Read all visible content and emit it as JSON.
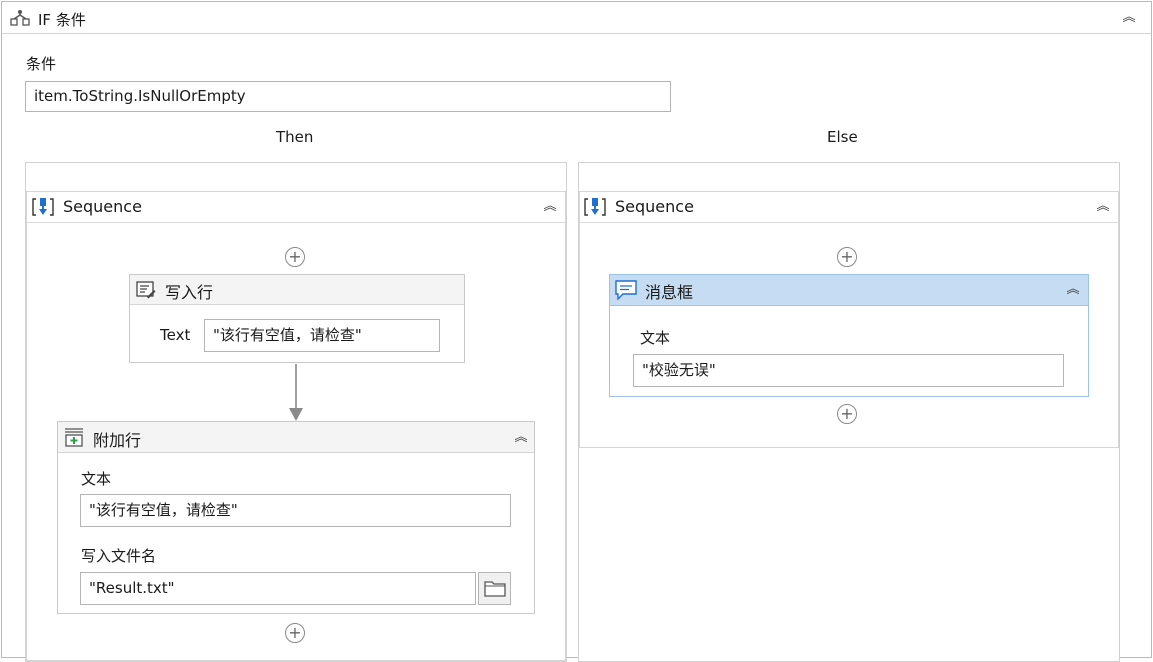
{
  "if_activity": {
    "title": "IF 条件",
    "condition_label": "条件",
    "condition_value": "item.ToString.IsNullOrEmpty",
    "then_label": "Then",
    "else_label": "Else",
    "collapse_glyph": "︽"
  },
  "then_sequence": {
    "title": "Sequence",
    "add_glyph": "+",
    "write_line": {
      "title": "写入行",
      "text_label": "Text",
      "text_value": "\"该行有空值，请检查\""
    },
    "append_line": {
      "title": "附加行",
      "text_label": "文本",
      "text_value": "\"该行有空值，请检查\"",
      "file_label": "写入文件名",
      "file_value": "\"Result.txt\"",
      "browse_icon": "folder-icon"
    }
  },
  "else_sequence": {
    "title": "Sequence",
    "add_glyph": "+",
    "message_box": {
      "title": "消息框",
      "text_label": "文本",
      "text_value": "\"校验无误\""
    }
  },
  "colors": {
    "selected_header": "#c5dcf2",
    "selected_border": "#9dc3e6",
    "sequence_icon": "#1f6fd1",
    "append_icon": "#2e9e4f"
  }
}
